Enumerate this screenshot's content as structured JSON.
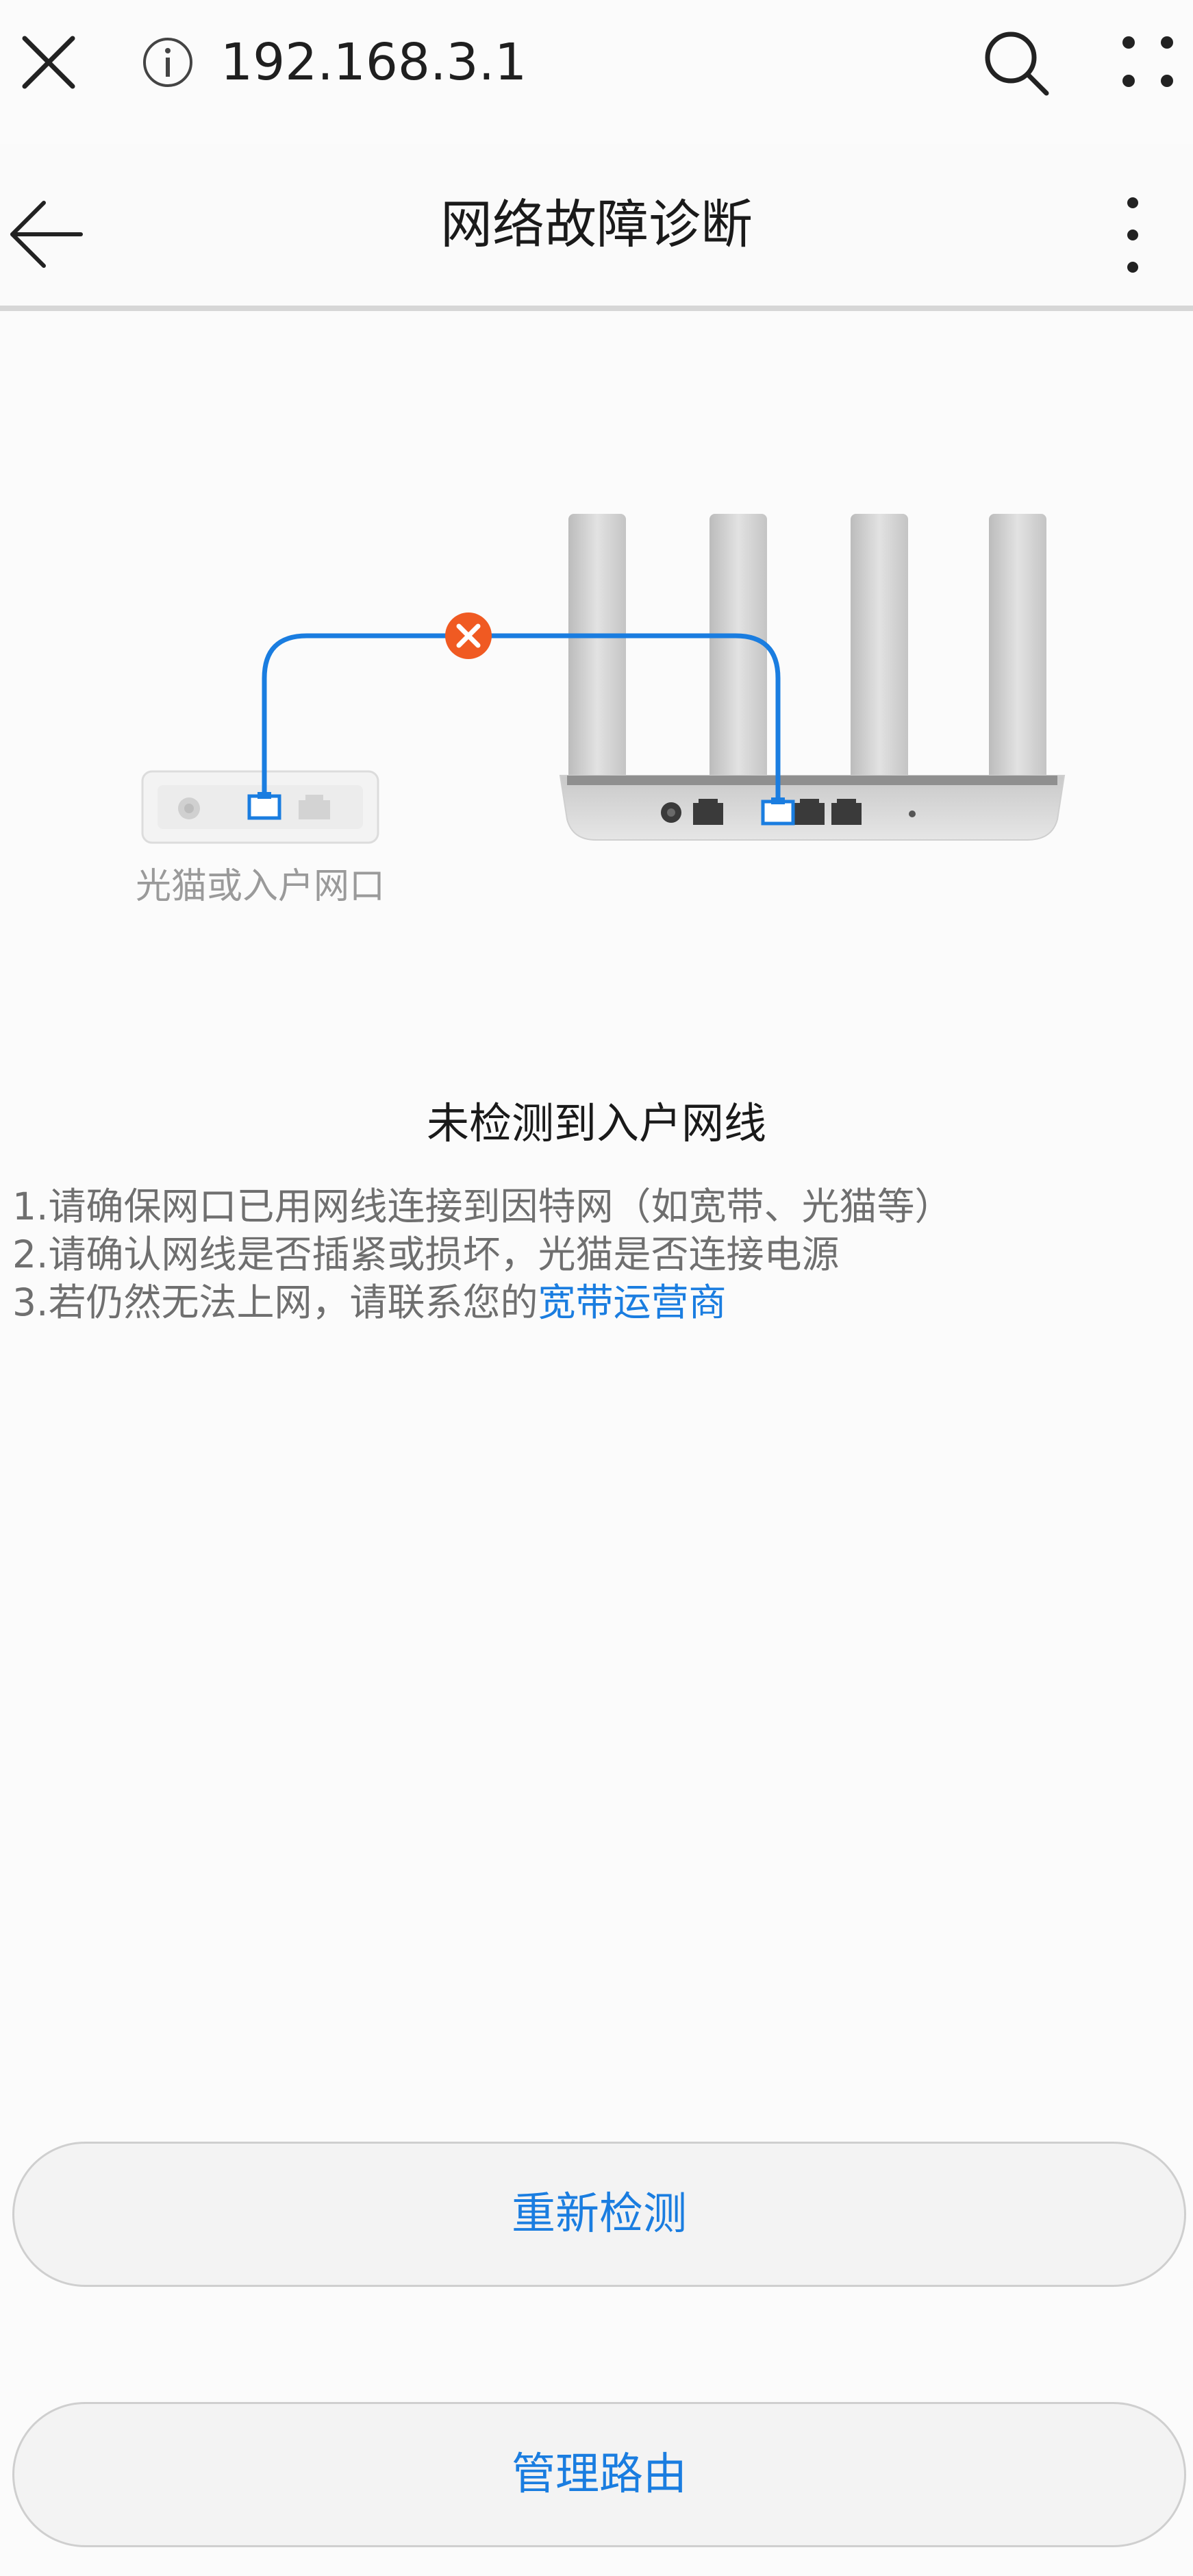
{
  "browser": {
    "url": "192.168.3.1",
    "icons": [
      "close-icon",
      "info-icon",
      "search-icon",
      "apps-icon"
    ]
  },
  "header": {
    "title": "网络故障诊断",
    "icons": [
      "back-arrow-icon",
      "more-vertical-icon"
    ]
  },
  "illustration": {
    "device_label": "光猫或入户网口",
    "error_icon": "error-x-icon",
    "cable_color": "#1a7de0",
    "error_color": "#f05a22"
  },
  "status": {
    "title": "未检测到入户网线",
    "tips": [
      "1.请确保网口已用网线连接到因特网（如宽带、光猫等）",
      "2.请确认网线是否插紧或损坏，光猫是否连接电源"
    ],
    "tip3_prefix": "3.若仍然无法上网，请联系您的",
    "tip3_link": "宽带运营商"
  },
  "buttons": {
    "recheck": "重新检测",
    "manage_router": "管理路由"
  },
  "colors": {
    "accent": "#1a7de0",
    "background": "#fbfbfb"
  }
}
